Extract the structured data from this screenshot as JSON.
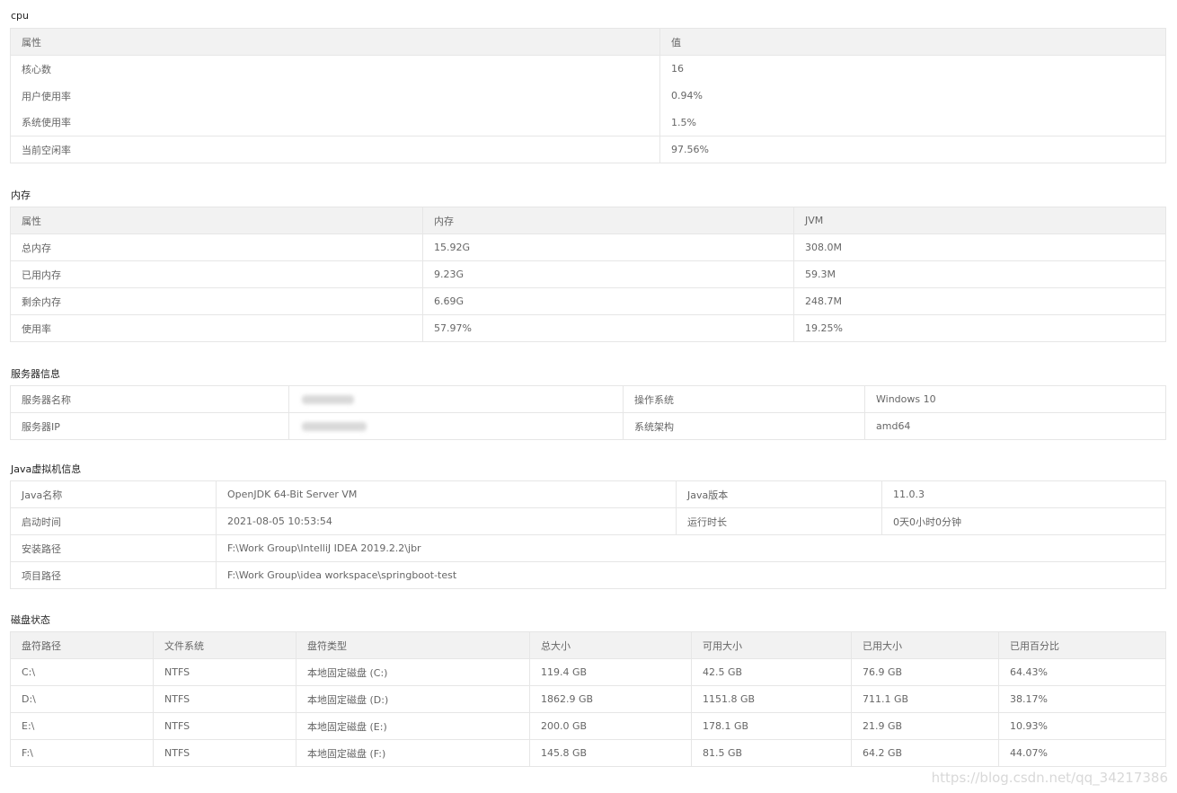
{
  "cpu": {
    "title": "cpu",
    "headers": [
      "属性",
      "值"
    ],
    "rows": [
      [
        "核心数",
        "16"
      ],
      [
        "用户使用率",
        "0.94%"
      ],
      [
        "系统使用率",
        "1.5%"
      ],
      [
        "当前空闲率",
        "97.56%"
      ]
    ]
  },
  "memory": {
    "title": "内存",
    "headers": [
      "属性",
      "内存",
      "JVM"
    ],
    "rows": [
      [
        "总内存",
        "15.92G",
        "308.0M"
      ],
      [
        "已用内存",
        "9.23G",
        "59.3M"
      ],
      [
        "剩余内存",
        "6.69G",
        "248.7M"
      ],
      [
        "使用率",
        "57.97%",
        "19.25%"
      ]
    ]
  },
  "server": {
    "title": "服务器信息",
    "rows": [
      [
        "服务器名称",
        "",
        "操作系统",
        "Windows 10"
      ],
      [
        "服务器IP",
        "",
        "系统架构",
        "amd64"
      ]
    ]
  },
  "jvm": {
    "title": "Java虚拟机信息",
    "rows": [
      [
        "Java名称",
        "OpenJDK 64-Bit Server VM",
        "Java版本",
        "11.0.3"
      ],
      [
        "启动时间",
        "2021-08-05 10:53:54",
        "运行时长",
        "0天0小时0分钟"
      ],
      [
        "安装路径",
        "F:\\Work Group\\IntelliJ IDEA 2019.2.2\\jbr"
      ],
      [
        "项目路径",
        "F:\\Work Group\\idea workspace\\springboot-test"
      ]
    ]
  },
  "disk": {
    "title": "磁盘状态",
    "headers": [
      "盘符路径",
      "文件系统",
      "盘符类型",
      "总大小",
      "可用大小",
      "已用大小",
      "已用百分比"
    ],
    "rows": [
      [
        "C:\\",
        "NTFS",
        "本地固定磁盘 (C:)",
        "119.4 GB",
        "42.5 GB",
        "76.9 GB",
        "64.43%"
      ],
      [
        "D:\\",
        "NTFS",
        "本地固定磁盘 (D:)",
        "1862.9 GB",
        "1151.8 GB",
        "711.1 GB",
        "38.17%"
      ],
      [
        "E:\\",
        "NTFS",
        "本地固定磁盘 (E:)",
        "200.0 GB",
        "178.1 GB",
        "21.9 GB",
        "10.93%"
      ],
      [
        "F:\\",
        "NTFS",
        "本地固定磁盘 (F:)",
        "145.8 GB",
        "81.5 GB",
        "64.2 GB",
        "44.07%"
      ]
    ]
  },
  "watermark": "https://blog.csdn.net/qq_34217386"
}
